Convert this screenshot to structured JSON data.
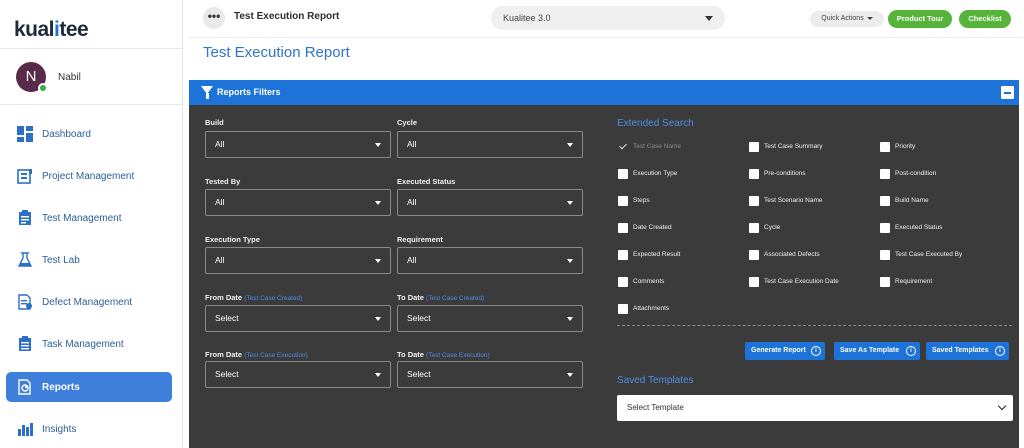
{
  "app": {
    "logo_pre": "kual",
    "logo_post": "tee"
  },
  "user": {
    "initial": "N",
    "name": "Nabil"
  },
  "sidebar": {
    "items": [
      {
        "label": "Dashboard",
        "icon": "dashboard-icon",
        "active": false
      },
      {
        "label": "Project Management",
        "icon": "project-icon",
        "active": false
      },
      {
        "label": "Test Management",
        "icon": "test-management-icon",
        "active": false
      },
      {
        "label": "Test Lab",
        "icon": "flask-icon",
        "active": false
      },
      {
        "label": "Defect Management",
        "icon": "defect-icon",
        "active": false
      },
      {
        "label": "Task Management",
        "icon": "task-icon",
        "active": false
      },
      {
        "label": "Reports",
        "icon": "reports-icon",
        "active": true
      },
      {
        "label": "Insights",
        "icon": "insights-icon",
        "active": false
      }
    ]
  },
  "topbar": {
    "more_label": "•••",
    "title": "Test Execution Report",
    "project": "Kualitee 3.0",
    "quick_actions": "Quick Actions",
    "product_tour": "Product Tour",
    "checklist": "Checklist"
  },
  "page": {
    "title": "Test Execution Report"
  },
  "filters": {
    "header": "Reports Filters",
    "build": {
      "label": "Build",
      "value": "All"
    },
    "cycle": {
      "label": "Cycle",
      "value": "All"
    },
    "tested_by": {
      "label": "Tested By",
      "value": "All"
    },
    "executed_status": {
      "label": "Executed Status",
      "value": "All"
    },
    "execution_type": {
      "label": "Execution Type",
      "value": "All"
    },
    "requirement": {
      "label": "Requirement",
      "value": "All"
    },
    "from_date_created": {
      "label": "From Date",
      "sub": "(Test Case Created)",
      "value": "Select"
    },
    "to_date_created": {
      "label": "To Date",
      "sub": "(Test Case Created)",
      "value": "Select"
    },
    "from_date_exec": {
      "label": "From Date",
      "sub": "(Test Case Execution)",
      "value": "Select"
    },
    "to_date_exec": {
      "label": "To Date",
      "sub": "(Test Case Execution)",
      "value": "Select"
    }
  },
  "extended": {
    "title": "Extended Search",
    "col1": [
      "Test Case Name",
      "Execution Type",
      "Steps",
      "Date Created",
      "Expected Result",
      "Comments",
      "Attachments"
    ],
    "col2": [
      "Test Case Summary",
      "Pre-conditions",
      "Test Scenario Name",
      "Cycle",
      "Associated Defects",
      "Test Case Execution Date"
    ],
    "col3": [
      "Priority",
      "Post-condition",
      "Build Name",
      "Executed Status",
      "Test Case Executed By",
      "Requirement"
    ]
  },
  "actions": {
    "generate": "Generate Report",
    "save_template": "Save As Template",
    "saved_templates": "Saved Templates"
  },
  "saved": {
    "title": "Saved Templates",
    "select_value": "Select Template"
  },
  "colors": {
    "accent": "#1e73d8",
    "panel": "#3b3b3b",
    "green": "#56b43a"
  }
}
